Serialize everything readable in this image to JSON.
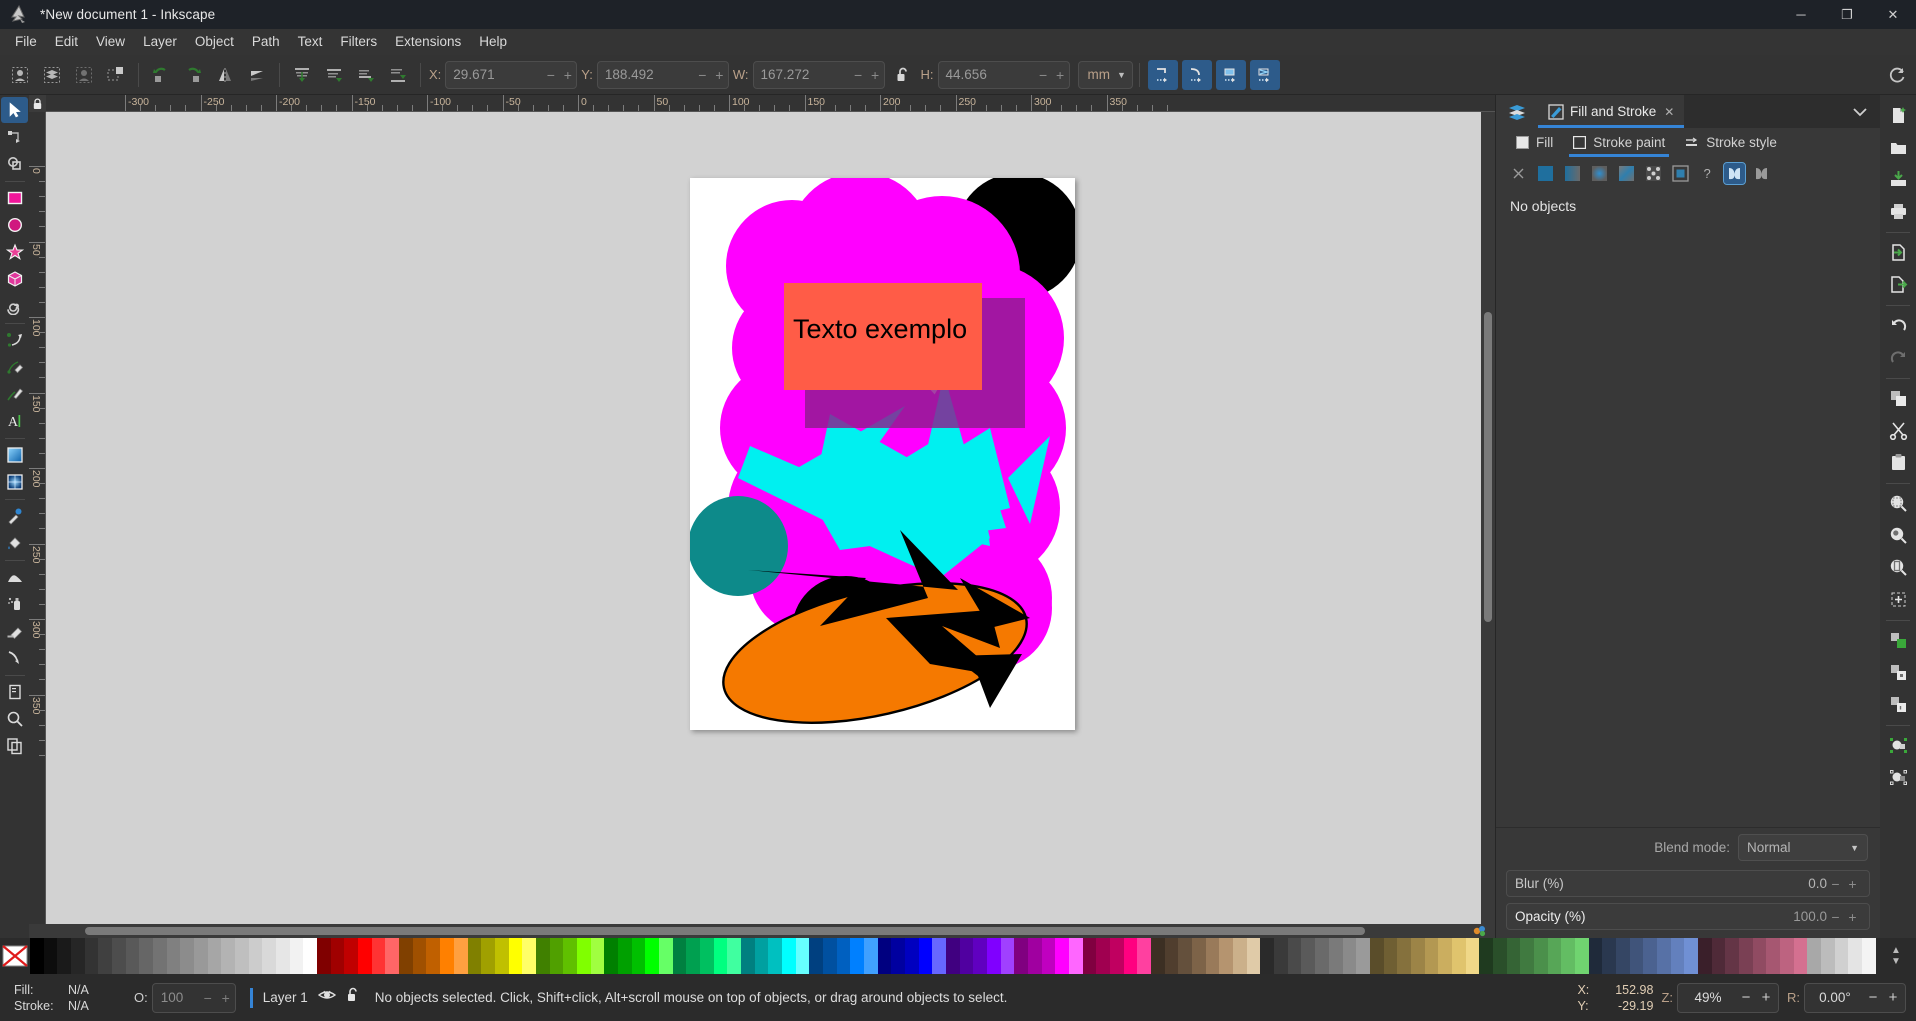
{
  "window": {
    "title": "*New document 1 - Inkscape",
    "logo_icon": "inkscape-logo-icon",
    "controls": [
      {
        "name": "minimize-button",
        "glyph": "─"
      },
      {
        "name": "maximize-button",
        "glyph": "❐"
      },
      {
        "name": "close-button",
        "glyph": "✕"
      }
    ]
  },
  "menubar": {
    "items": [
      "File",
      "Edit",
      "View",
      "Layer",
      "Object",
      "Path",
      "Text",
      "Filters",
      "Extensions",
      "Help"
    ]
  },
  "toolcontrols": {
    "select_all_icon": "select-all-icon",
    "select_all_layers_icon": "select-all-in-all-layers-icon",
    "deselect_icon": "deselect-icon",
    "select_same_icon": "select-same-icon",
    "rotate_ccw_icon": "rotate-90-ccw-icon",
    "rotate_cw_icon": "rotate-90-cw-icon",
    "flip_h_icon": "flip-horizontal-icon",
    "flip_v_icon": "flip-vertical-icon",
    "raise_top_icon": "raise-to-top-icon",
    "raise_icon": "raise-one-step-icon",
    "lower_icon": "lower-one-step-icon",
    "lower_bottom_icon": "lower-to-bottom-icon",
    "fields": [
      {
        "name": "x-field",
        "label": "X:",
        "value": "29.671"
      },
      {
        "name": "y-field",
        "label": "Y:",
        "value": "188.492"
      },
      {
        "name": "w-field",
        "label": "W:",
        "value": "167.272"
      },
      {
        "name": "h-field",
        "label": "H:",
        "value": "44.656"
      }
    ],
    "lock_icon": "lock-open-icon",
    "unit": {
      "name": "unit-selector",
      "value": "mm"
    },
    "snap_buttons": [
      {
        "name": "snap-bbox-corner-button",
        "icon": "snap-bbox-corner-icon"
      },
      {
        "name": "snap-bbox-edge-midpoint-button",
        "icon": "snap-bbox-edge-mid-icon"
      },
      {
        "name": "snap-bbox-center-button",
        "icon": "snap-bbox-center-icon"
      },
      {
        "name": "snap-bbox-edge-button",
        "icon": "snap-bbox-edge-icon"
      }
    ],
    "reset_icon": "reset-transform-icon"
  },
  "toolbox": {
    "tools": [
      {
        "name": "tool-selector",
        "icon": "arrow-cursor-icon",
        "active": true
      },
      {
        "name": "tool-node-editor",
        "icon": "node-editor-icon",
        "active": false
      },
      {
        "name": "tool-boolean",
        "icon": "boolean-ops-icon",
        "active": false
      },
      {
        "name": "tool-rectangle",
        "icon": "rectangle-icon",
        "active": false
      },
      {
        "name": "tool-ellipse",
        "icon": "ellipse-icon",
        "active": false
      },
      {
        "name": "tool-star",
        "icon": "star-icon",
        "active": false
      },
      {
        "name": "tool-3dbox",
        "icon": "3d-box-icon",
        "active": false
      },
      {
        "name": "tool-spiral",
        "icon": "spiral-icon",
        "active": false
      },
      {
        "name": "tool-bezier",
        "icon": "bezier-pen-icon",
        "active": false
      },
      {
        "name": "tool-pencil",
        "icon": "pencil-icon",
        "active": false
      },
      {
        "name": "tool-calligraphy",
        "icon": "calligraphy-brush-icon",
        "active": false
      },
      {
        "name": "tool-text",
        "icon": "text-A-icon",
        "active": false
      },
      {
        "name": "tool-gradient",
        "icon": "gradient-icon",
        "active": false
      },
      {
        "name": "tool-mesh-gradient",
        "icon": "mesh-gradient-icon",
        "active": false
      },
      {
        "name": "tool-dropper",
        "icon": "eyedropper-icon",
        "active": false
      },
      {
        "name": "tool-paint-bucket",
        "icon": "paint-bucket-icon",
        "active": false
      },
      {
        "name": "tool-tweak",
        "icon": "tweak-icon",
        "active": false
      },
      {
        "name": "tool-spray",
        "icon": "spray-can-icon",
        "active": false
      },
      {
        "name": "tool-eraser",
        "icon": "eraser-icon",
        "active": false
      },
      {
        "name": "tool-connector",
        "icon": "connector-icon",
        "active": false
      },
      {
        "name": "tool-pages",
        "icon": "page-icon",
        "active": false
      },
      {
        "name": "tool-zoom",
        "icon": "magnifier-icon",
        "active": false
      },
      {
        "name": "tool-measure",
        "icon": "copies-icon",
        "active": false
      }
    ]
  },
  "rulers": {
    "horizontal_labels": [
      "-300",
      "-250",
      "-200",
      "-150",
      "-100",
      "-50",
      "0",
      "50",
      "100",
      "150",
      "200",
      "250",
      "300",
      "350"
    ],
    "vertical_labels": [
      "0",
      "50",
      "100",
      "150",
      "200",
      "250",
      "300",
      "350"
    ],
    "lock_icon": "ruler-lock-icon"
  },
  "canvas": {
    "artwork_alt": "abstract composition with magenta blob, black circles, cyan shards, orange ellipse",
    "text_object": "Texto exemplo",
    "colors": {
      "page": "#ffffff",
      "background": "#d2d2d2",
      "magenta": "#ff00ff",
      "black": "#000000",
      "cyan": "#00f0f0",
      "teal": "#0d8a8a",
      "orange": "#f57900",
      "salmon": "#ff5c47",
      "purple_shadow": "#8e1b8e"
    },
    "sticky_zoom_icon": "sticky-zoom-icon"
  },
  "dock": {
    "tabs": [
      {
        "name": "dock-tab-layers",
        "label": "",
        "icon": "layers-icon",
        "active": false,
        "icon_only": true
      },
      {
        "name": "dock-tab-fill-and-stroke",
        "label": "Fill and Stroke",
        "icon": "fill-stroke-icon",
        "active": true,
        "icon_only": false
      }
    ],
    "chevron_icon": "chevron-down-icon",
    "fill_stroke": {
      "tabs": [
        {
          "name": "tab-fill",
          "label": "Fill",
          "icon": "fill-square-icon",
          "active": false
        },
        {
          "name": "tab-stroke-paint",
          "label": "Stroke paint",
          "icon": "stroke-square-icon",
          "active": true
        },
        {
          "name": "tab-stroke-style",
          "label": "Stroke style",
          "icon": "stroke-style-icon",
          "active": false
        }
      ],
      "paint_buttons": [
        {
          "name": "paint-none-button",
          "icon": "x-icon",
          "selected": false
        },
        {
          "name": "paint-flat-color-button",
          "icon": "flat-color-icon",
          "selected": false
        },
        {
          "name": "paint-linear-gradient-button",
          "icon": "linear-gradient-icon",
          "selected": false
        },
        {
          "name": "paint-radial-gradient-button",
          "icon": "radial-gradient-icon",
          "selected": false
        },
        {
          "name": "paint-mesh-gradient-button",
          "icon": "mesh-gradient-icon",
          "selected": false
        },
        {
          "name": "paint-pattern-button",
          "icon": "pattern-icon",
          "selected": false
        },
        {
          "name": "paint-swatch-button",
          "icon": "swatch-icon",
          "selected": false
        },
        {
          "name": "paint-unknown-button",
          "icon": "question-mark-icon",
          "selected": false
        },
        {
          "name": "paint-fill-rule-nonzero-button",
          "icon": "fill-rule-nonzero-icon",
          "selected": true
        },
        {
          "name": "paint-fill-rule-evenodd-button",
          "icon": "fill-rule-evenodd-icon",
          "selected": false
        }
      ],
      "empty_message": "No objects",
      "blend_mode": {
        "label": "Blend mode:",
        "value": "Normal"
      },
      "blur": {
        "label": "Blur (%)",
        "value": "0.0"
      },
      "opacity": {
        "label": "Opacity (%)",
        "value": "100.0"
      }
    }
  },
  "commandbar": {
    "items": [
      {
        "name": "new-document-button",
        "icon": "new-document-icon"
      },
      {
        "name": "open-document-button",
        "icon": "open-folder-icon"
      },
      {
        "name": "save-document-button",
        "icon": "save-icon"
      },
      {
        "name": "print-document-button",
        "icon": "printer-icon"
      },
      {
        "name": "import-button",
        "icon": "import-icon"
      },
      {
        "name": "export-button",
        "icon": "export-icon"
      },
      {
        "name": "undo-button",
        "icon": "undo-arrow-icon"
      },
      {
        "name": "redo-button",
        "icon": "redo-arrow-icon"
      },
      {
        "name": "copy-button",
        "icon": "copy-icon"
      },
      {
        "name": "cut-button",
        "icon": "scissors-icon"
      },
      {
        "name": "paste-button",
        "icon": "clipboard-icon"
      },
      {
        "name": "zoom-selection-button",
        "icon": "zoom-selection-icon"
      },
      {
        "name": "zoom-drawing-button",
        "icon": "zoom-drawing-icon"
      },
      {
        "name": "zoom-page-button",
        "icon": "zoom-page-icon"
      },
      {
        "name": "zoom-fit-button",
        "icon": "zoom-fit-icon"
      },
      {
        "name": "duplicate-button",
        "icon": "duplicate-icon"
      },
      {
        "name": "group-button",
        "icon": "group-lock-icon"
      },
      {
        "name": "ungroup-button",
        "icon": "ungroup-icon"
      },
      {
        "name": "object-properties-button",
        "icon": "object-properties-icon"
      },
      {
        "name": "xml-editor-button",
        "icon": "xml-editor-icon"
      }
    ]
  },
  "palette": {
    "none_swatch": {
      "name": "swatch-none",
      "icon": "no-color-icon"
    },
    "colors": [
      "#000000",
      "#0d0d0d",
      "#1a1a1a",
      "#262626",
      "#333333",
      "#404040",
      "#4d4d4d",
      "#595959",
      "#666666",
      "#737373",
      "#808080",
      "#8c8c8c",
      "#999999",
      "#a6a6a6",
      "#b3b3b3",
      "#bfbfbf",
      "#cccccc",
      "#d9d9d9",
      "#e6e6e6",
      "#f2f2f2",
      "#ffffff",
      "#800000",
      "#a00000",
      "#c00000",
      "#ff0000",
      "#ff3333",
      "#ff6666",
      "#804000",
      "#a05000",
      "#c06000",
      "#ff8000",
      "#ffa040",
      "#808000",
      "#a0a000",
      "#c0c000",
      "#ffff00",
      "#ffff66",
      "#408000",
      "#50a000",
      "#60c000",
      "#80ff00",
      "#a0ff40",
      "#008000",
      "#00a000",
      "#00c000",
      "#00ff00",
      "#66ff66",
      "#008040",
      "#00a050",
      "#00c060",
      "#00ff80",
      "#40ffa0",
      "#008080",
      "#00a0a0",
      "#00c0c0",
      "#00ffff",
      "#66ffff",
      "#004080",
      "#0050a0",
      "#0060c0",
      "#0080ff",
      "#40a0ff",
      "#000080",
      "#0000a0",
      "#0000c0",
      "#0000ff",
      "#6666ff",
      "#400080",
      "#5000a0",
      "#6000c0",
      "#8000ff",
      "#a040ff",
      "#800080",
      "#a000a0",
      "#c000c0",
      "#ff00ff",
      "#ff66ff",
      "#800040",
      "#a00050",
      "#c00060",
      "#ff0080",
      "#ff40a0",
      "#3c2f23",
      "#503e2e",
      "#64503c",
      "#7d6348",
      "#997a5a",
      "#b5946f",
      "#cbb08a",
      "#e0cba8",
      "#2a2a2a",
      "#3a3a3a",
      "#4a4a4a",
      "#5a5a5a",
      "#6a6a6a",
      "#7a7a7a",
      "#8a8a8a",
      "#9a9a9a",
      "#5a4d2a",
      "#6f5f33",
      "#85713d",
      "#9c8447",
      "#b39852",
      "#cbae5f",
      "#e0c46d",
      "#f0d888",
      "#1f3a1f",
      "#2a4f2a",
      "#356435",
      "#407a40",
      "#4b904b",
      "#57a657",
      "#63bd63",
      "#70d470",
      "#1f2a3a",
      "#2a384f",
      "#354664",
      "#40547a",
      "#4b6290",
      "#5771a6",
      "#6380bd",
      "#7090d4",
      "#3a1f2a",
      "#4f2a38",
      "#643546",
      "#7a4054",
      "#904b62",
      "#a65771",
      "#bd6380",
      "#d47090",
      "#a8a8a8",
      "#bcbcbc",
      "#d0d0d0",
      "#e4e4e4",
      "#f4f4f4"
    ],
    "scroll_up_icon": "chevron-up-icon",
    "scroll_menu_icon": "chevron-down-icon"
  },
  "statusbar": {
    "fill_label": "Fill:",
    "fill_value": "N/A",
    "stroke_label": "Stroke:",
    "stroke_value": "N/A",
    "opacity_label": "O:",
    "opacity_value": "100",
    "layer_name": "Layer 1",
    "layer_visibility_icon": "eye-icon",
    "layer_lock_icon": "lock-open-icon",
    "message": "No objects selected. Click, Shift+click, Alt+scroll mouse on top of objects, or drag around objects to select.",
    "cursor_x_label": "X:",
    "cursor_x_value": "152.98",
    "cursor_y_label": "Y:",
    "cursor_y_value": "-29.19",
    "zoom_label": "Z:",
    "zoom_value": "49%",
    "rotation_label": "R:",
    "rotation_value": "0.00°"
  }
}
